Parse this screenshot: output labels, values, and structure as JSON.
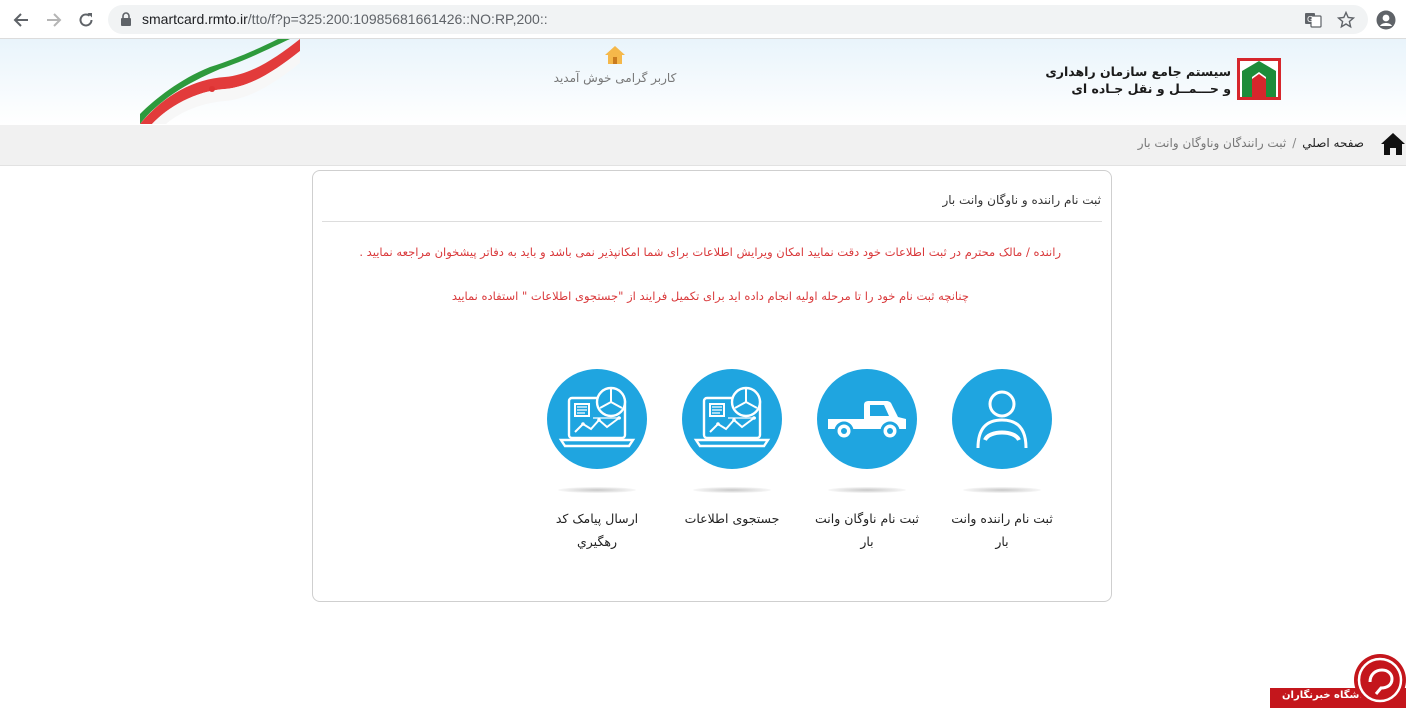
{
  "browser": {
    "url_host": "smartcard.rmto.ir",
    "url_path": "/tto/f?p=325:200:10985681661426::NO:RP,200::"
  },
  "header": {
    "welcome_text": "کاربر گرامی خوش آمدید",
    "org_line1": "سیستم جامع سازمان راهداری",
    "org_line2": "و حـــمــل و نقل جـاده ای"
  },
  "breadcrumb": {
    "home": "صفحه اصلي",
    "separator": "/",
    "current": "ثبت رانندگان وناوگان وانت بار"
  },
  "card": {
    "title": "ثبت نام راننده و ناوگان وانت بار",
    "notice1": "راننده / مالک محترم در ثبت اطلاعات خود دقت نمایید امکان ویرایش اطلاعات برای شما امکانپذیر نمی باشد و باید به دفاتر پیشخوان مراجعه نمایید .",
    "notice2": "چنانچه ثبت نام خود را تا مرحله اولیه انجام داده اید برای تکمیل فرایند از \"جستجوی اطلاعات \" استفاده نمایید"
  },
  "tiles": [
    {
      "line1": "ثبت نام راننده وانت",
      "line2": "بار",
      "icon": "driver-icon"
    },
    {
      "line1": "ثبت نام ناوگان وانت",
      "line2": "بار",
      "icon": "pickup-truck-icon"
    },
    {
      "line1": "جستجوی اطلاعات",
      "line2": "",
      "icon": "laptop-chart-icon"
    },
    {
      "line1": "ارسال پیامک کد",
      "line2": "رهگیري",
      "icon": "laptop-chart-icon"
    }
  ],
  "watermark": {
    "text": "باشگاه خبرنگاران"
  },
  "colors": {
    "accent": "#1fa5e0",
    "notice": "#d9393b",
    "watermark": "#c4161c"
  }
}
